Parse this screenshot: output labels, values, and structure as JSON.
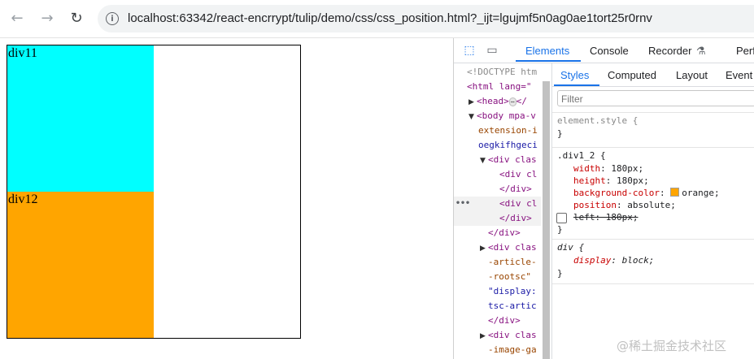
{
  "browser": {
    "url": "localhost:63342/react-encrrypt/tulip/demo/css/css_position.html?_ijt=lgujmf5n0ag0ae1tort25r0rnv",
    "back_glyph": "←",
    "forward_glyph": "→",
    "reload_glyph": "↻",
    "info_glyph": "i"
  },
  "page": {
    "div11_label": "div11",
    "div12_label": "div12",
    "colors": {
      "div11": "#00ffff",
      "div12": "#ffa500"
    }
  },
  "devtools": {
    "inspect_glyph": "⬚",
    "device_glyph": "▭",
    "tabs": [
      "Elements",
      "Console",
      "Recorder",
      "Perf"
    ],
    "recorder_icon_glyph": "⚗",
    "dom": [
      {
        "text": "<!DOCTYPE htm"
      },
      {
        "text": "<html lang=\""
      },
      {
        "tri": "▶",
        "text": "<head>",
        "pill": "⋯",
        "after": "</"
      },
      {
        "tri": "▼",
        "text": "<body mpa-v"
      },
      {
        "text": "extension-i"
      },
      {
        "text": "oegkifhgeci"
      },
      {
        "tri": "▼",
        "text": "<div clas"
      },
      {
        "text": "<div cl"
      },
      {
        "text": "</div>"
      },
      {
        "text": "<div cl"
      },
      {
        "text": "</div>"
      },
      {
        "text": "</div>"
      },
      {
        "tri": "▶",
        "text": "<div clas"
      },
      {
        "text": "-article-"
      },
      {
        "text": "-rootsc\""
      },
      {
        "text": "\"display:"
      },
      {
        "text": "tsc-artic"
      },
      {
        "text": "</div>"
      },
      {
        "tri": "▶",
        "text": "<div clas"
      },
      {
        "text": "-image-ga"
      }
    ],
    "selected_dots": "•••",
    "styles_tabs": [
      "Styles",
      "Computed",
      "Layout",
      "Event L"
    ],
    "filter_placeholder": "Filter",
    "element_style": "element.style {",
    "close_brace": "}",
    "rule1_selector": ".div1_2 {",
    "rule1": [
      {
        "prop": "width",
        "value": "180px;"
      },
      {
        "prop": "height",
        "value": "180px;"
      },
      {
        "prop": "background-color",
        "value": "orange;"
      },
      {
        "prop": "position",
        "value": "absolute;"
      }
    ],
    "disabled_decl": "left: 180px;",
    "swatch_color": "#ffa500",
    "rule2_selector": "div {",
    "rule2_prop": "display",
    "rule2_value": "block;",
    "watermark": "@稀土掘金技术社区"
  }
}
